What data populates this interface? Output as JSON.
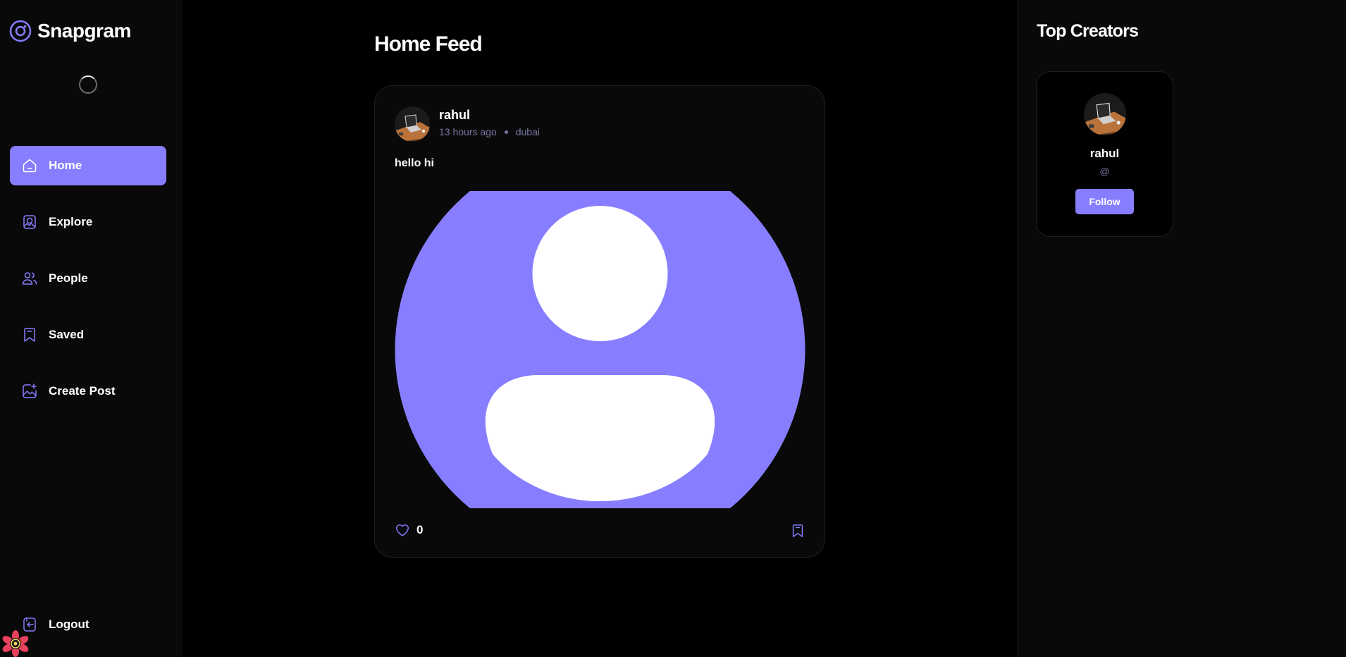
{
  "app": {
    "name": "Snapgram"
  },
  "sidebar": {
    "items": [
      {
        "label": "Home",
        "icon": "home-icon",
        "active": true
      },
      {
        "label": "Explore",
        "icon": "explore-icon",
        "active": false
      },
      {
        "label": "People",
        "icon": "people-icon",
        "active": false
      },
      {
        "label": "Saved",
        "icon": "bookmark-icon",
        "active": false
      },
      {
        "label": "Create Post",
        "icon": "create-post-icon",
        "active": false
      }
    ],
    "logout_label": "Logout"
  },
  "main": {
    "title": "Home Feed",
    "post": {
      "author": "rahul",
      "time": "13 hours ago",
      "location": "dubai",
      "caption": "hello hi",
      "likes": "0"
    }
  },
  "right": {
    "title": "Top Creators",
    "creator": {
      "name": "rahul",
      "handle": "@",
      "follow_label": "Follow"
    }
  },
  "colors": {
    "accent": "#877eff",
    "muted": "#7878a3",
    "background": "#000000",
    "panel": "#09090a"
  }
}
